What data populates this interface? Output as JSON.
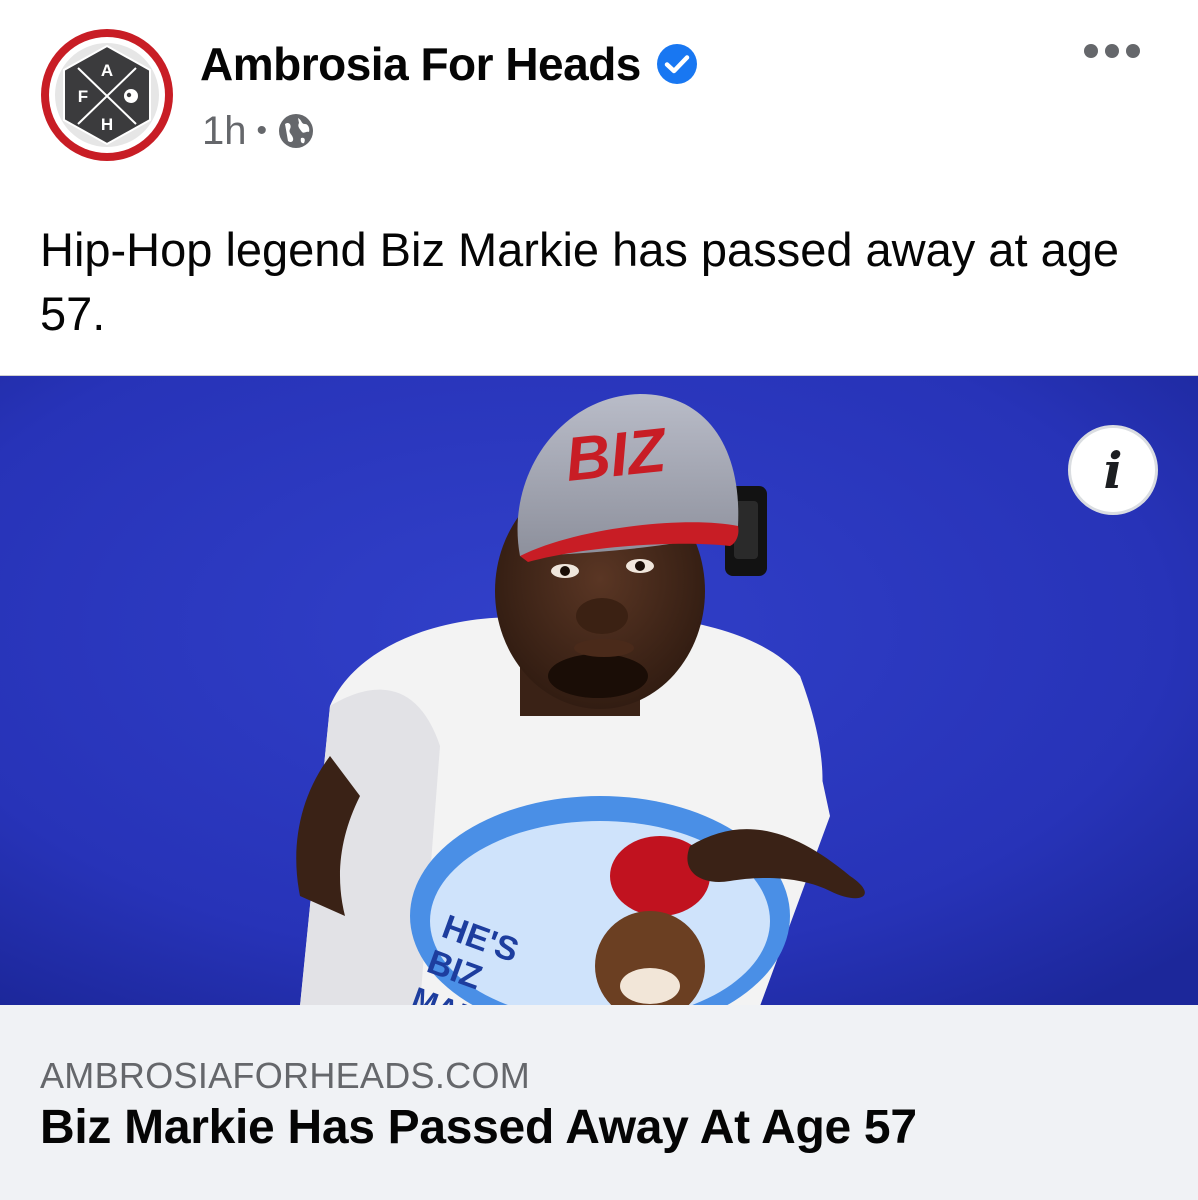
{
  "post": {
    "page_name": "Ambrosia For Heads",
    "timestamp": "1h",
    "separator": "•",
    "text": "Hip-Hop legend Biz Markie has passed away at age 57."
  },
  "avatar": {
    "letters": {
      "top": "A",
      "left": "F",
      "bottom": "H"
    }
  },
  "image": {
    "cap_text": "BIZ",
    "shirt_text_1": "HE'S",
    "shirt_text_2": "BIZ",
    "shirt_text_3": "MARKIE",
    "info_icon": "i"
  },
  "link": {
    "domain": "AMBROSIAFORHEADS.COM",
    "title": "Biz Markie Has Passed Away At Age 57"
  },
  "colors": {
    "verified": "#1877f2",
    "photo_background": "#2733b8",
    "link_background": "#f0f2f5",
    "meta_text": "#65676b"
  },
  "icons": [
    "avatar-logo",
    "verified-badge-icon",
    "globe-icon",
    "more-options-icon",
    "info-icon"
  ]
}
